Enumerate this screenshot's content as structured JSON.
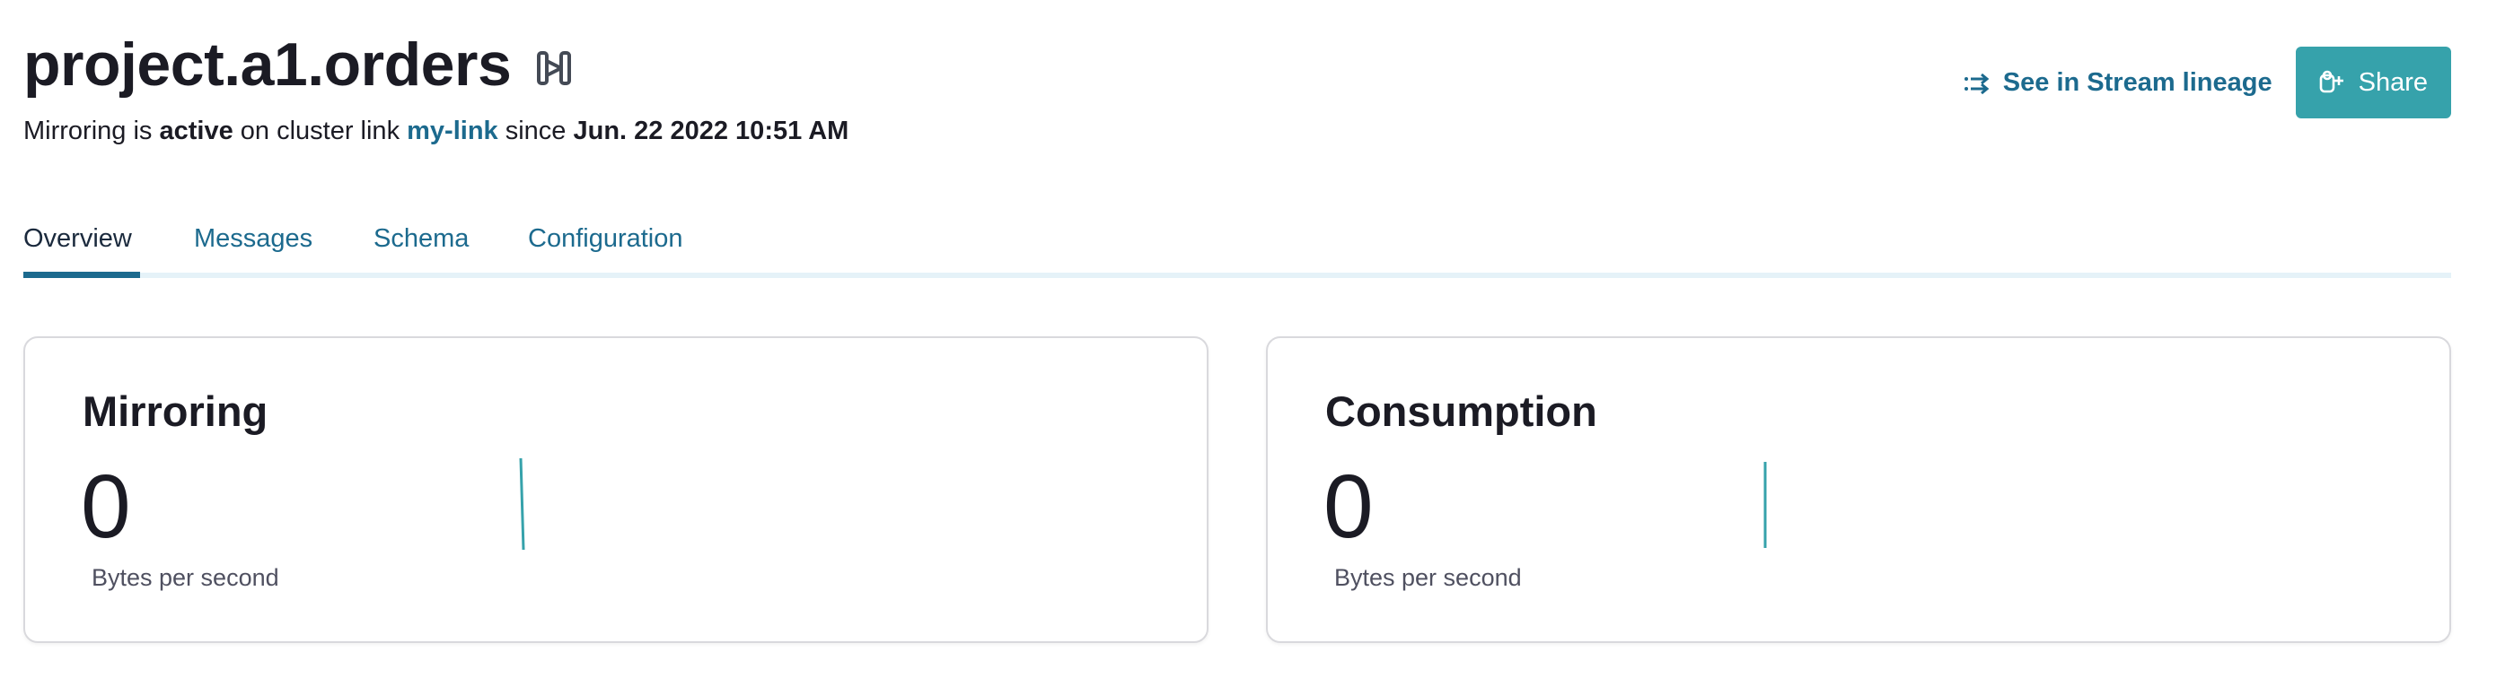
{
  "topic": {
    "name": "project.a1.orders",
    "icon": "mirror-topic-icon"
  },
  "status": {
    "prefix": "Mirroring is",
    "state": "active",
    "link_text": "on cluster link",
    "link_name": "my-link",
    "since_text": "since",
    "timestamp": "Jun. 22 2022 10:51 AM"
  },
  "actions": {
    "lineage_label": "See in Stream lineage",
    "lineage_icon": "stream-lineage-icon",
    "share_label": "Share",
    "share_icon": "share-icon"
  },
  "tabs": [
    {
      "label": "Overview",
      "active": true
    },
    {
      "label": "Messages",
      "active": false
    },
    {
      "label": "Schema",
      "active": false
    },
    {
      "label": "Configuration",
      "active": false
    }
  ],
  "cards": {
    "mirroring": {
      "title": "Mirroring",
      "value": "0",
      "unit": "Bytes per second"
    },
    "consumption": {
      "title": "Consumption",
      "value": "0",
      "unit": "Bytes per second"
    }
  },
  "colors": {
    "accent": "#36a2ab",
    "link": "#1c6a8e",
    "tab_rail": "#e5f2f8",
    "text": "#1b1b24"
  }
}
